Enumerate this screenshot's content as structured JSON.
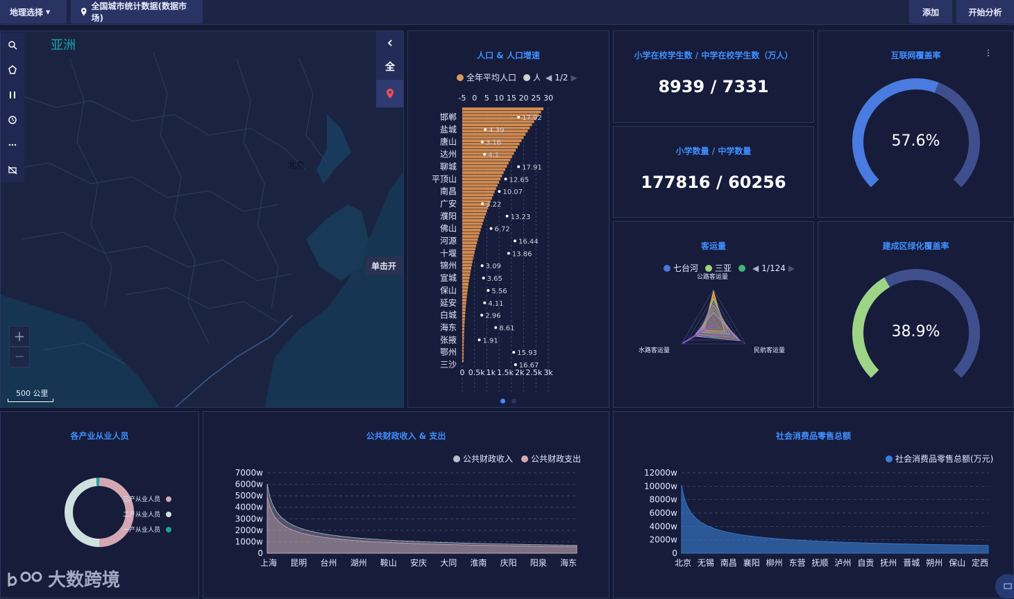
{
  "topbar": {
    "geo_select": "地理选择",
    "dataset": "全国城市统计数据(数据市场)",
    "add": "添加",
    "analyze": "开始分析"
  },
  "map": {
    "region_label": "亚洲",
    "city_label": "北京",
    "side_full": "全",
    "click_hint": "单击开",
    "scale": "500 公里",
    "zoom_in": "+",
    "zoom_out": "−",
    "watermark": "大数跨境"
  },
  "population": {
    "title": "人口 & 人口增速",
    "legend_1": "全年平均人口",
    "legend_2": "人",
    "page": "1/2",
    "top_ticks": [
      "-5",
      "0",
      "5",
      "10",
      "15",
      "20",
      "25",
      "30"
    ],
    "bottom_ticks": [
      "0",
      "0.5k",
      "1k",
      "1.5k",
      "2k",
      "2.5k",
      "3k"
    ]
  },
  "students": {
    "title": "小学在校学生数 / 中学在校学生数（万人）",
    "value": "8939 / 7331"
  },
  "schools": {
    "title": "小学数量 / 中学数量",
    "value": "177816 / 60256"
  },
  "internet": {
    "title": "互联网覆盖率",
    "value": "57.6%",
    "ratio": 0.576,
    "color": "#4a7be0"
  },
  "green": {
    "title": "建成区绿化覆盖率",
    "value": "38.9%",
    "ratio": 0.389,
    "color": "#9ed485"
  },
  "passenger": {
    "title": "客运量",
    "legend_1": "七台河",
    "legend_2": "三亚",
    "page": "1/124",
    "axis_top": "公路客运量",
    "axis_left": "水路客运量",
    "axis_right": "民航客运量"
  },
  "employment": {
    "title": "各产业从业人员",
    "legend": [
      "三产从业人员",
      "二产从业人员",
      "一产从业人员"
    ],
    "colors": [
      "#d4a7b2",
      "#cfe1df",
      "#1aa39b"
    ]
  },
  "finance": {
    "title": "公共财政收入 & 支出",
    "legend_1": "公共财政收入",
    "legend_2": "公共财政支出",
    "y_ticks": [
      "7000w",
      "6000w",
      "5000w",
      "4000w",
      "3000w",
      "2000w",
      "1000w",
      "0"
    ],
    "x_ticks": [
      "上海",
      "昆明",
      "台州",
      "湖州",
      "鞍山",
      "安庆",
      "大同",
      "淮南",
      "庆阳",
      "阳泉",
      "海东"
    ]
  },
  "retail": {
    "title": "社会消费品零售总额",
    "legend": "社会消费品零售总额(万元)",
    "y_ticks": [
      "12000w",
      "10000w",
      "8000w",
      "6000w",
      "4000w",
      "2000w",
      "0"
    ],
    "x_ticks": [
      "北京",
      "无锡",
      "南昌",
      "襄阳",
      "柳州",
      "东营",
      "抚顺",
      "泸州",
      "自贡",
      "抚州",
      "晋城",
      "朔州",
      "保山",
      "定西"
    ]
  },
  "chart_data": [
    {
      "type": "bar",
      "title": "人口 & 人口增速",
      "categories": [
        "邯郸",
        "盐城",
        "唐山",
        "达州",
        "聊城",
        "平顶山",
        "南昌",
        "广安",
        "濮阳",
        "佛山",
        "河源",
        "十堰",
        "锦州",
        "宣城",
        "保山",
        "延安",
        "白城",
        "海东",
        "张掖",
        "鄂州",
        "三沙"
      ],
      "series": [
        {
          "name": "人口增速",
          "values": [
            17.92,
            4.39,
            3.16,
            4.1,
            17.91,
            12.65,
            10.07,
            3.22,
            13.23,
            6.72,
            16.44,
            13.86,
            3.09,
            3.65,
            5.56,
            4.11,
            2.96,
            8.61,
            1.91,
            15.93,
            16.67
          ]
        }
      ],
      "xlim_top": [
        -5,
        30
      ],
      "xlim_bottom": [
        0,
        3000
      ]
    },
    {
      "type": "area",
      "title": "公共财政收入 & 支出",
      "ylim": [
        0,
        7000
      ],
      "series": [
        {
          "name": "公共财政收入",
          "peak": 6100
        },
        {
          "name": "公共财政支出",
          "peak": 5000
        }
      ]
    },
    {
      "type": "area",
      "title": "社会消费品零售总额",
      "ylim": [
        0,
        12000
      ],
      "series": [
        {
          "name": "社会消费品零售总额(万元)",
          "peak": 10300
        }
      ]
    }
  ]
}
